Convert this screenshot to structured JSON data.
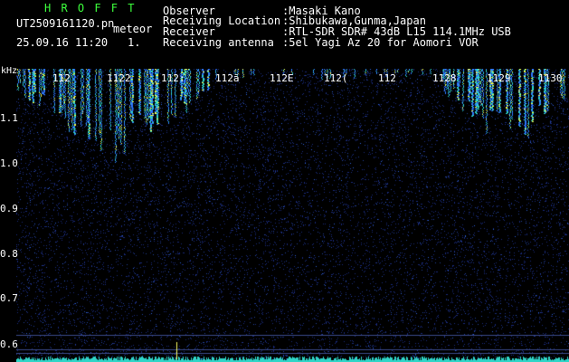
{
  "header": {
    "program_name": "H R O F F T",
    "filename": "UT2509161120.pn",
    "mode": "meteor",
    "datetime": "25.09.16 11:20",
    "index": "1.",
    "rows": [
      {
        "label": "Observer",
        "value": ":Masaki Kano"
      },
      {
        "label": "Receiving Location",
        "value": ":Shibukawa,Gunma,Japan"
      },
      {
        "label": "Receiver",
        "value": ":RTL-SDR SDR# 43dB L15 114.1MHz USB"
      },
      {
        "label": "Receiving antenna",
        "value": ":5el Yagi Az 20 for Aomori VOR"
      }
    ]
  },
  "axes": {
    "unit": "kHz",
    "y_ticks": [
      "1.1",
      "1.0",
      "0.9",
      "0.8",
      "0.7",
      "0.6"
    ],
    "x_ticks": [
      "112",
      "1122",
      "112:",
      "112ā",
      "112Е",
      "112(",
      "112",
      "1128",
      "1129",
      "1130"
    ]
  },
  "colors": {
    "background": "#000000",
    "header_program": "#3cff3c",
    "noise": "#1a2a7a",
    "signal_low": "#2e78ff",
    "signal_mid": "#2fd6c8",
    "signal_high": "#f0ff50",
    "marker_line": "#ffff66"
  }
}
